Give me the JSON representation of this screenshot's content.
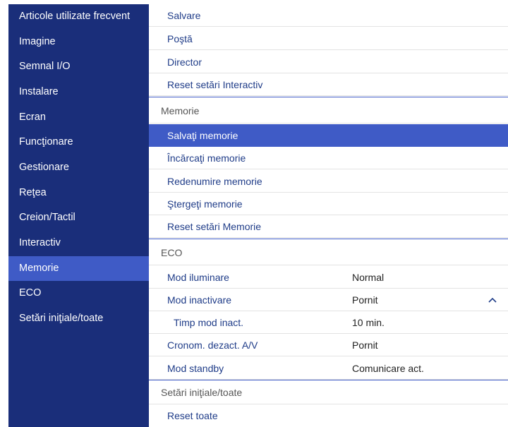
{
  "sidebar": {
    "items": [
      {
        "label": "Articole utilizate frecvent"
      },
      {
        "label": "Imagine"
      },
      {
        "label": "Semnal I/O"
      },
      {
        "label": "Instalare"
      },
      {
        "label": "Ecran"
      },
      {
        "label": "Funcţionare"
      },
      {
        "label": "Gestionare"
      },
      {
        "label": "Reţea"
      },
      {
        "label": "Creion/Tactil"
      },
      {
        "label": "Interactiv"
      },
      {
        "label": "Memorie"
      },
      {
        "label": "ECO"
      },
      {
        "label": "Setări iniţiale/toate"
      }
    ],
    "active_index": 10
  },
  "main": {
    "rows": [
      {
        "label": "Salvare"
      },
      {
        "label": "Poştă"
      },
      {
        "label": "Director"
      },
      {
        "label": "Reset setări Interactiv"
      },
      {
        "label": "Memorie",
        "section": true
      },
      {
        "label": "Salvaţi memorie",
        "selected": true
      },
      {
        "label": "Încărcaţi memorie"
      },
      {
        "label": "Redenumire memorie"
      },
      {
        "label": "Ştergeţi memorie"
      },
      {
        "label": "Reset setări Memorie"
      },
      {
        "label": "ECO",
        "section": true
      },
      {
        "label": "Mod iluminare",
        "value": "Normal"
      },
      {
        "label": "Mod inactivare",
        "value": "Pornit",
        "expanded": true
      },
      {
        "label": "Timp mod inact.",
        "value": "10 min.",
        "sub": true
      },
      {
        "label": "Cronom. dezact. A/V",
        "value": "Pornit"
      },
      {
        "label": "Mod standby",
        "value": "Comunicare act."
      },
      {
        "label": "Setări iniţiale/toate",
        "section": true
      },
      {
        "label": "Reset toate"
      }
    ]
  },
  "colors": {
    "sidebar_bg": "#1a2e7a",
    "accent": "#3f5bc6",
    "item_text": "#1f3c88"
  },
  "icons": {
    "expand": "chevron-up-icon"
  }
}
